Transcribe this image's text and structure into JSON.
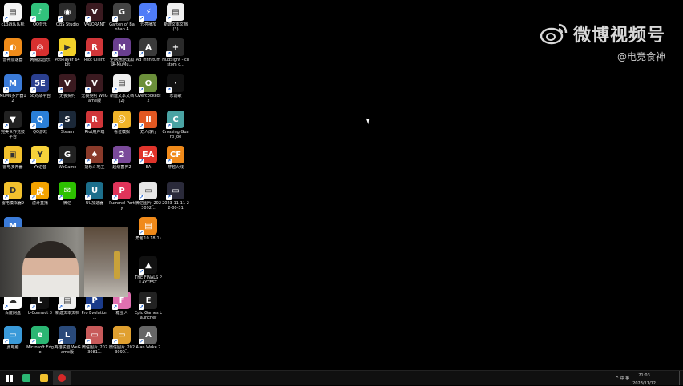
{
  "watermark": {
    "title": "微博视频号",
    "handle": "@电竞食神"
  },
  "taskbar": {
    "time": "21:03",
    "date": "2023/11/12",
    "tray_text": "^ 中 英",
    "pinned": [
      {
        "name": "windows-start",
        "color": "#1e90ff"
      },
      {
        "name": "edge",
        "color": "#2bb673"
      },
      {
        "name": "file-explorer",
        "color": "#f2c12e"
      },
      {
        "name": "red-app",
        "color": "#d62828"
      }
    ]
  },
  "desktop_icons": [
    {
      "col": 0,
      "row": 0,
      "label": "c13战队队标",
      "color": "#f5f5f5",
      "glyph": "▤"
    },
    {
      "col": 1,
      "row": 0,
      "label": "QQ音乐",
      "color": "#31c27c",
      "glyph": "♪"
    },
    {
      "col": 2,
      "row": 0,
      "label": "OBS Studio",
      "color": "#2a2a2a",
      "glyph": "◉"
    },
    {
      "col": 3,
      "row": 0,
      "label": "VALORANT",
      "color": "#3b1a20",
      "glyph": "V"
    },
    {
      "col": 4,
      "row": 0,
      "label": "Garten of Banban 4",
      "color": "#444",
      "glyph": "G"
    },
    {
      "col": 5,
      "row": 0,
      "label": "元亮播加",
      "color": "#4f7cf7",
      "glyph": "⚡"
    },
    {
      "col": 6,
      "row": 0,
      "label": "新建文本文档 (3)",
      "color": "#f0f0f0",
      "glyph": "▤"
    },
    {
      "col": 0,
      "row": 1,
      "label": "雷神加速器",
      "color": "#f08c1a",
      "glyph": "◐"
    },
    {
      "col": 1,
      "row": 1,
      "label": "网易云音乐",
      "color": "#d8302f",
      "glyph": "◎"
    },
    {
      "col": 2,
      "row": 1,
      "label": "PotPlayer 64 bit",
      "color": "#f2d12a",
      "glyph": "▶"
    },
    {
      "col": 3,
      "row": 1,
      "label": "Riot Client",
      "color": "#d13639",
      "glyph": "R"
    },
    {
      "col": 4,
      "row": 1,
      "label": "全网通游戏加速-MuMu...",
      "color": "#6a3f8f",
      "glyph": "M"
    },
    {
      "col": 5,
      "row": 1,
      "label": "Ad Infinitum",
      "color": "#3a3a3a",
      "glyph": "A"
    },
    {
      "col": 6,
      "row": 1,
      "label": "HudSight - custom c...",
      "color": "#2a2a2a",
      "glyph": "+"
    },
    {
      "col": 0,
      "row": 2,
      "label": "MuMu多开器12",
      "color": "#3b7bd8",
      "glyph": "M"
    },
    {
      "col": 1,
      "row": 2,
      "label": "5E对战平台",
      "color": "#2a3f8f",
      "glyph": "5E"
    },
    {
      "col": 2,
      "row": 2,
      "label": "无畏契约",
      "color": "#3b1a20",
      "glyph": "V"
    },
    {
      "col": 3,
      "row": 2,
      "label": "无畏契约 WeGame版",
      "color": "#3b1a20",
      "glyph": "V"
    },
    {
      "col": 4,
      "row": 2,
      "label": "新建文本文档 (2)",
      "color": "#f0f0f0",
      "glyph": "▤"
    },
    {
      "col": 5,
      "row": 2,
      "label": "Overcooked! 2",
      "color": "#6b8f3a",
      "glyph": "O"
    },
    {
      "col": 6,
      "row": 2,
      "label": "水调歌",
      "color": "#111",
      "glyph": "·"
    },
    {
      "col": 0,
      "row": 3,
      "label": "完美世界竞技平台",
      "color": "#222",
      "glyph": "▼"
    },
    {
      "col": 1,
      "row": 3,
      "label": "QQ游戏",
      "color": "#2a7fd8",
      "glyph": "Q"
    },
    {
      "col": 2,
      "row": 3,
      "label": "Steam",
      "color": "#1b2838",
      "glyph": "S"
    },
    {
      "col": 3,
      "row": 3,
      "label": "Riot用户端",
      "color": "#d13639",
      "glyph": "R"
    },
    {
      "col": 4,
      "row": 3,
      "label": "看位模拟",
      "color": "#f0b429",
      "glyph": "☺"
    },
    {
      "col": 5,
      "row": 3,
      "label": "双人成行",
      "color": "#e25822",
      "glyph": "II"
    },
    {
      "col": 6,
      "row": 3,
      "label": "Crossing Guard Joe",
      "color": "#4aa3a3",
      "glyph": "C"
    },
    {
      "col": 0,
      "row": 4,
      "label": "雷电多开器",
      "color": "#f2c12e",
      "glyph": "▣"
    },
    {
      "col": 1,
      "row": 4,
      "label": "YY语音",
      "color": "#f7d23a",
      "glyph": "Y"
    },
    {
      "col": 2,
      "row": 4,
      "label": "WeGame",
      "color": "#222",
      "glyph": "G"
    },
    {
      "col": 3,
      "row": 4,
      "label": "奶乐斗地主",
      "color": "#8a3a2a",
      "glyph": "♠"
    },
    {
      "col": 4,
      "row": 4,
      "label": "超级菌界2",
      "color": "#7a4a9a",
      "glyph": "2"
    },
    {
      "col": 5,
      "row": 4,
      "label": "EA",
      "color": "#e0342b",
      "glyph": "EA"
    },
    {
      "col": 6,
      "row": 4,
      "label": "穿越火线",
      "color": "#f08a1a",
      "glyph": "CF"
    },
    {
      "col": 0,
      "row": 5,
      "label": "雷电模拟器9",
      "color": "#f2c12e",
      "glyph": "D"
    },
    {
      "col": 1,
      "row": 5,
      "label": "虎牙直播",
      "color": "#f4a300",
      "glyph": "虎"
    },
    {
      "col": 2,
      "row": 5,
      "label": "微信",
      "color": "#2dc100",
      "glyph": "✉"
    },
    {
      "col": 3,
      "row": 5,
      "label": "UU加速器",
      "color": "#1c6f8c",
      "glyph": "U"
    },
    {
      "col": 4,
      "row": 5,
      "label": "Pummel Party",
      "color": "#e0345a",
      "glyph": "P"
    },
    {
      "col": 5,
      "row": 5,
      "label": "微信图片_2023092...",
      "color": "#e6e6e6",
      "glyph": "▭"
    },
    {
      "col": 6,
      "row": 5,
      "label": "2023-11-11 22-00-31",
      "color": "#2a2a3a",
      "glyph": "▭"
    },
    {
      "col": 0,
      "row": 6,
      "label": "",
      "color": "#3b7bd8",
      "glyph": "M"
    },
    {
      "col": 5,
      "row": 6,
      "label": "角色10.18(1)",
      "color": "#f08a1a",
      "glyph": "▤"
    },
    {
      "col": 5,
      "row": 7,
      "label": "THE FINALS PLAYTEST",
      "color": "#111",
      "glyph": "▲"
    },
    {
      "col": 0,
      "row": 8,
      "label": "百度网盘",
      "color": "#fff",
      "glyph": "☁"
    },
    {
      "col": 1,
      "row": 8,
      "label": "L-Connect 3",
      "color": "#111",
      "glyph": "L"
    },
    {
      "col": 2,
      "row": 8,
      "label": "新建文本文档",
      "color": "#f0f0f0",
      "glyph": "▤"
    },
    {
      "col": 3,
      "row": 8,
      "label": "Pro Evolution ...",
      "color": "#1a3a8a",
      "glyph": "P"
    },
    {
      "col": 4,
      "row": 8,
      "label": "糖豆人",
      "color": "#e070b0",
      "glyph": "F"
    },
    {
      "col": 5,
      "row": 8,
      "label": "Epic Games Launcher",
      "color": "#222",
      "glyph": "E"
    },
    {
      "col": 0,
      "row": 9,
      "label": "此电脑",
      "color": "#3a9ad9",
      "glyph": "▭"
    },
    {
      "col": 1,
      "row": 9,
      "label": "Microsoft Edge",
      "color": "#2bb673",
      "glyph": "e"
    },
    {
      "col": 2,
      "row": 9,
      "label": "英雄联盟 WeGame版",
      "color": "#2a4a7a",
      "glyph": "L"
    },
    {
      "col": 3,
      "row": 9,
      "label": "微信图片_2023081...",
      "color": "#c85a5a",
      "glyph": "▭"
    },
    {
      "col": 4,
      "row": 9,
      "label": "微信图片_2023090...",
      "color": "#e0a030",
      "glyph": "▭"
    },
    {
      "col": 5,
      "row": 9,
      "label": "Alan Wake 2",
      "color": "#666",
      "glyph": "A"
    }
  ]
}
